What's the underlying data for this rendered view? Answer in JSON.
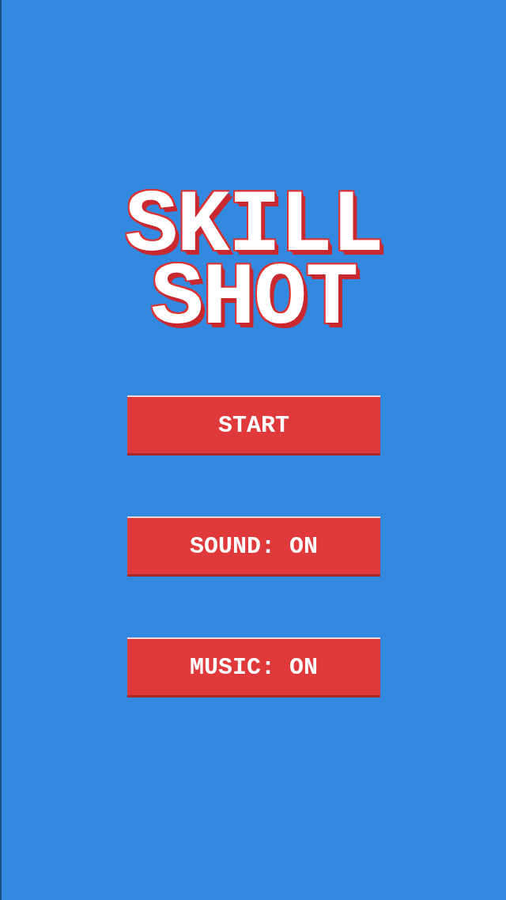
{
  "title": {
    "lines": [
      "SKILL",
      "SHOT"
    ]
  },
  "buttons": [
    {
      "label": "START"
    },
    {
      "label": "SOUND: ON"
    },
    {
      "label": "MUSIC: ON"
    }
  ]
}
